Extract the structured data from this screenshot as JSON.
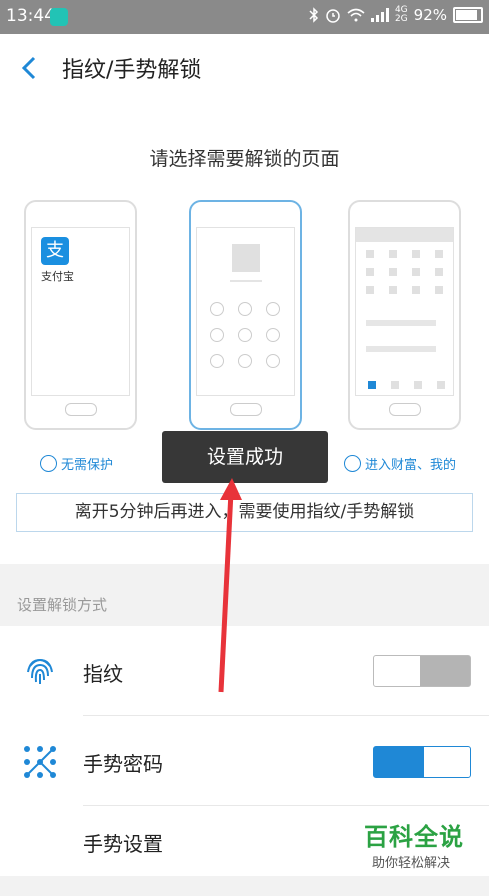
{
  "status_bar": {
    "time": "13:44",
    "net_top": "4G",
    "net_bottom": "2G",
    "battery": "92%"
  },
  "header": {
    "title": "指纹/手势解锁"
  },
  "prompt": "请选择需要解锁的页面",
  "alipay": {
    "logo_char": "支",
    "name": "支付宝"
  },
  "options": [
    {
      "label": "无需保护"
    },
    {
      "label": "进入财富、我的"
    }
  ],
  "notice": "离开5分钟后再进入，需要使用指纹/手势解锁",
  "section_label": "设置解锁方式",
  "rows": {
    "fingerprint": {
      "label": "指纹",
      "enabled": false
    },
    "gesture": {
      "label": "手势密码",
      "enabled": true
    },
    "gesture_settings": {
      "label": "手势设置"
    }
  },
  "toast": "设置成功",
  "watermark": {
    "main": "百科全说",
    "sub": "助你轻松解决"
  },
  "colors": {
    "accent": "#1f88d6",
    "toast_bg": "#373737",
    "arrow": "#e8333a",
    "watermark": "#2ba243"
  }
}
